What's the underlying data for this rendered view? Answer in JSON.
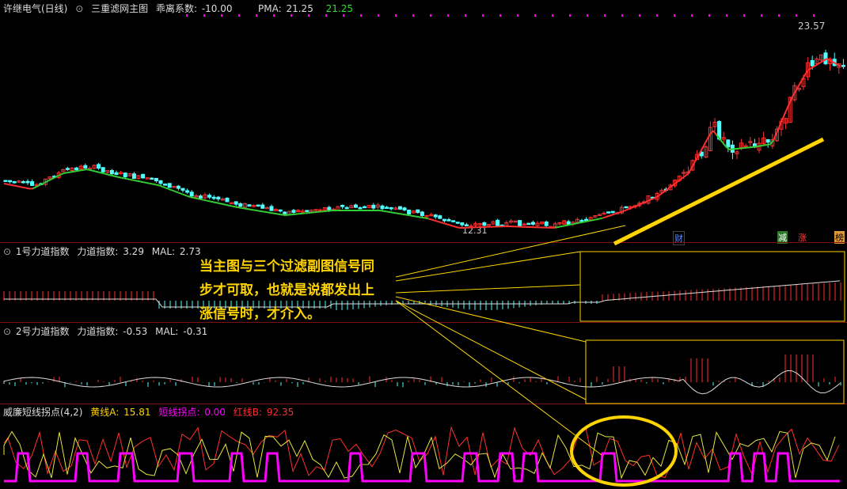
{
  "main": {
    "stock_name": "许继电气(日线)",
    "indicator_name": "三重滤网主图",
    "deviation_label": "乖离系数:",
    "deviation_value": "-10.00",
    "pma_label": "PMA:",
    "pma_value1": "21.25",
    "pma_value2": "21.25",
    "high_price": "23.57",
    "low_price": "12.31",
    "signal_labels": {
      "cai": "财",
      "jian": "减",
      "zhang": "涨",
      "bang": "榜"
    }
  },
  "pane1": {
    "title": "1号力道指数",
    "value_label": "力道指数:",
    "value": "3.29",
    "mal_label": "MAL:",
    "mal": "2.73"
  },
  "pane2": {
    "title": "2号力道指数",
    "value_label": "力道指数:",
    "value": "-0.53",
    "mal_label": "MAL:",
    "mal": "-0.31"
  },
  "pane3": {
    "title": "威廉短线拐点(4,2)",
    "yellow_label": "黄线A:",
    "yellow": "15.81",
    "magenta_label": "短线拐点:",
    "magenta": "0.00",
    "red_label": "红线B:",
    "red": "92.35"
  },
  "annotation": {
    "line1": "当主图与三个过滤副图信号同",
    "line2": "步才可取，也就是说都发出上",
    "line3": "涨信号时，才介入。"
  },
  "colors": {
    "bg": "#000000",
    "up": "#ff3030",
    "down": "#54ffff",
    "yellow": "#ffd400",
    "magenta": "#ff00ff",
    "green": "#33cc33",
    "sep": "#7a1010"
  }
}
